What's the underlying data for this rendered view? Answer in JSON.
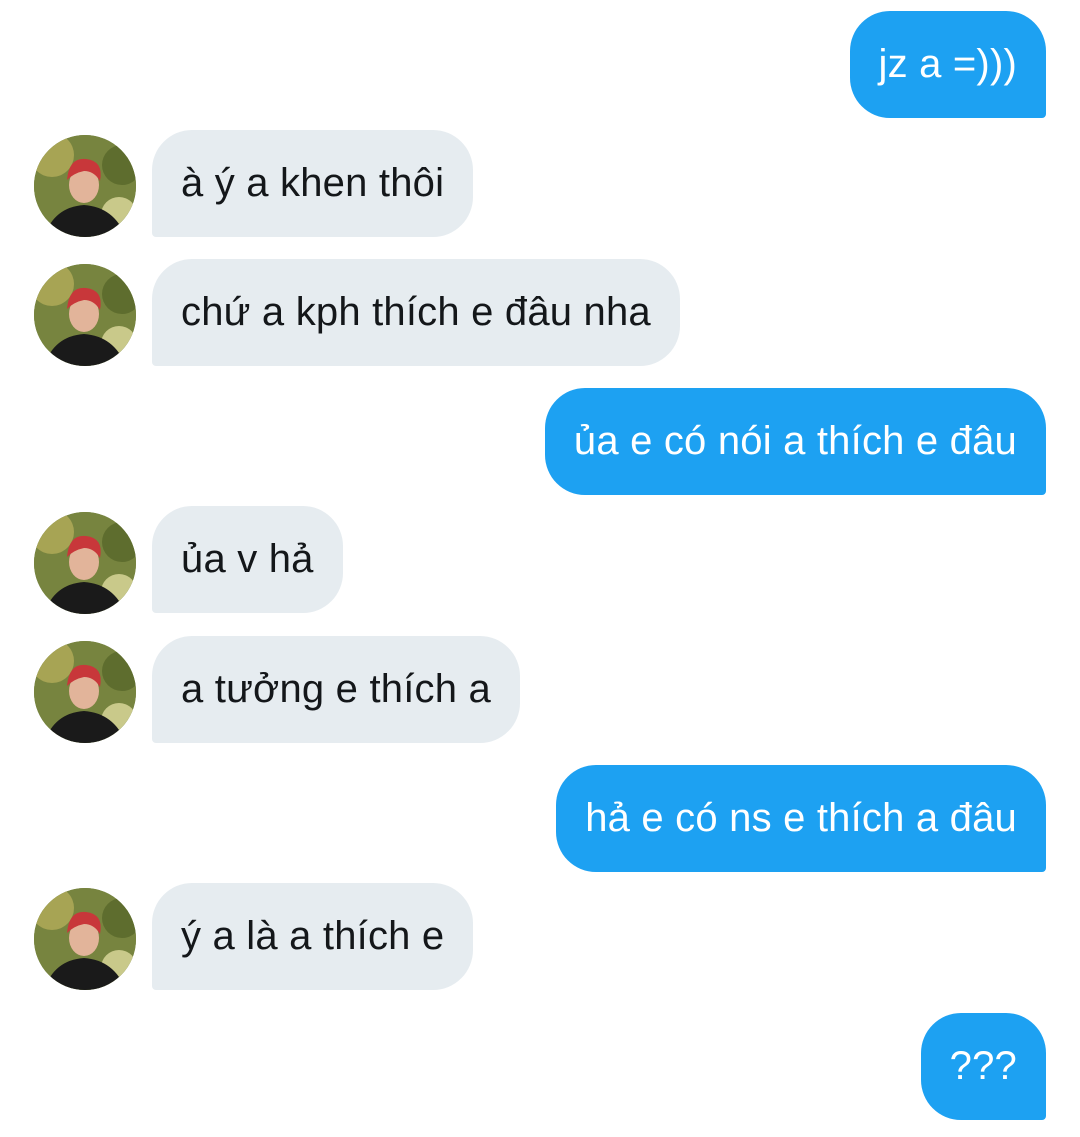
{
  "conversation": {
    "messages": [
      {
        "from": "me",
        "text": "jz a =)))"
      },
      {
        "from": "them",
        "text": "à ý a khen thôi"
      },
      {
        "from": "them",
        "text": "chứ a kph thích e đâu nha"
      },
      {
        "from": "me",
        "text": "ủa e có nói a thích e đâu"
      },
      {
        "from": "them",
        "text": "ủa v hả"
      },
      {
        "from": "them",
        "text": "a tưởng e thích a"
      },
      {
        "from": "me",
        "text": "hả e có ns e thích a đâu"
      },
      {
        "from": "them",
        "text": "ý a là a thích e"
      },
      {
        "from": "me",
        "text": "???"
      }
    ]
  },
  "colors": {
    "outgoing_bubble": "#1da1f2",
    "incoming_bubble": "#e6ecf0",
    "outgoing_text": "#ffffff",
    "incoming_text": "#14171a"
  },
  "icons": {
    "contact_avatar": "avatar-photo"
  }
}
